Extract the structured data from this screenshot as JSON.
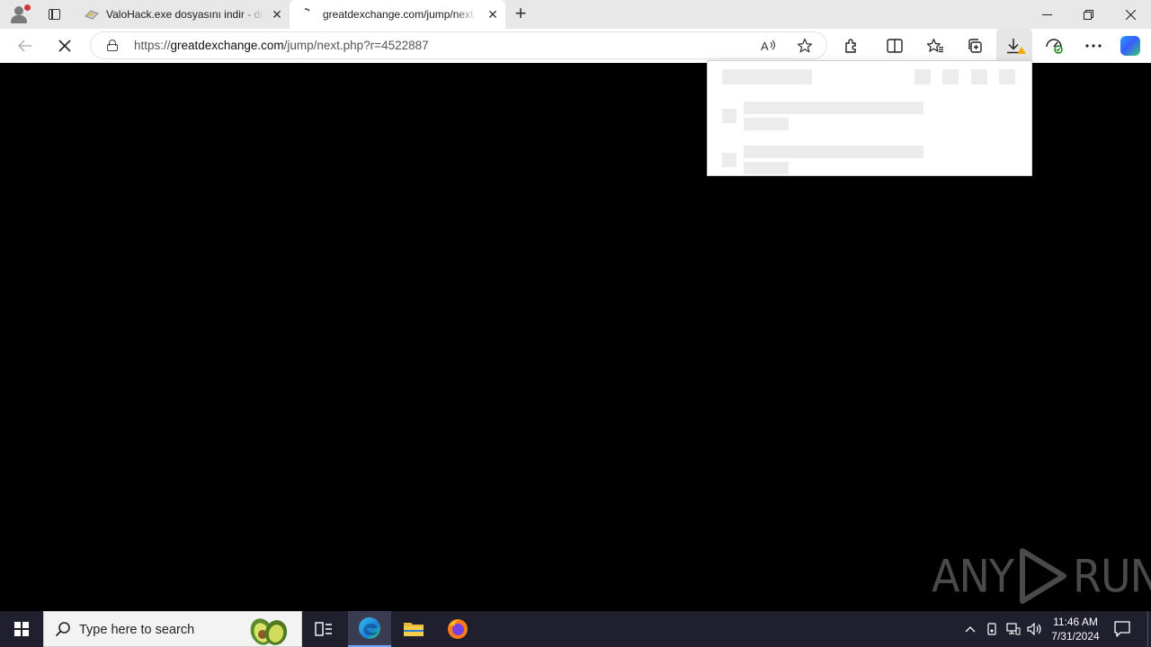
{
  "browser": {
    "tabs": [
      {
        "title": "ValoHack.exe dosyasını indir - do",
        "favicon": "page-icon",
        "active": false
      },
      {
        "title": "greatdexchange.com/jump/next.p",
        "favicon": "loading-icon",
        "active": true
      }
    ],
    "address": {
      "scheme": "https://",
      "host": "greatdexchange.com",
      "path": "/jump/next.php?r=4522887"
    },
    "toolbar_icons": [
      "read-aloud-icon",
      "favorite-star-icon",
      "extensions-icon",
      "split-screen-icon",
      "favorites-icon",
      "collections-icon",
      "downloads-icon",
      "performance-icon",
      "more-icon",
      "copilot-icon"
    ]
  },
  "content": {
    "watermark_left": "ANY",
    "watermark_right": "RUN"
  },
  "taskbar": {
    "search_placeholder": "Type here to search",
    "time": "11:46 AM",
    "date": "7/31/2024"
  },
  "colors": {
    "tabstrip": "#e8e8e8",
    "page_background": "#000000",
    "taskbar": "#1f1f2e",
    "download_warning": "#f2a900"
  }
}
